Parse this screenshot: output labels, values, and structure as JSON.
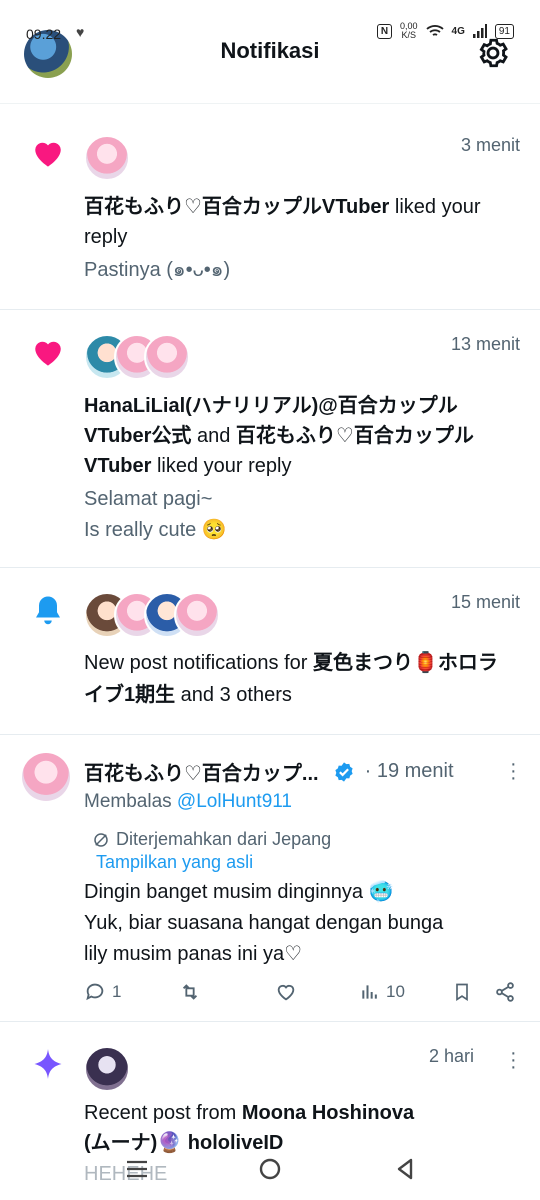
{
  "status": {
    "time": "09.22",
    "net_speed_value": "0,00",
    "net_speed_unit": "K/S",
    "network": "4G",
    "battery": "91"
  },
  "header": {
    "title": "Notifikasi"
  },
  "notifications": [
    {
      "type": "like",
      "time": "3 menit",
      "name1": "百花もふり♡百合カップルVTuber",
      "action": " liked your reply",
      "snippet": [
        "Pastinya (๑•ᴗ•๑)"
      ]
    },
    {
      "type": "like",
      "time": "13 menit",
      "name1": "HanaLiLial(ハナリリアル)@百合カップルVTuber公式",
      "joiner": " and ",
      "name2": "百花もふり♡百合カップルVTuber",
      "action": " liked your reply",
      "snippet": [
        "Selamat pagi~",
        "Is really cute 🥺"
      ]
    },
    {
      "type": "bell",
      "time": "15 menit",
      "prefix": "New post notifications for ",
      "name1": "夏色まつり🏮ホロライブ1期生",
      "suffix": " and 3 others"
    }
  ],
  "reply_tweet": {
    "author": "百花もふり♡百合カップ...",
    "time": "· 19 menit",
    "replying_label": "Membalas ",
    "replying_handle": "@LolHunt911",
    "translated_label": "Diterjemahkan dari Jepang",
    "show_original": "Tampilkan yang asli",
    "body": [
      "Dingin banget musim dinginnya 🥶",
      "Yuk, biar suasana hangat dengan bunga",
      "lily musim panas ini ya♡"
    ],
    "replies": "1",
    "views": "10"
  },
  "recent_post": {
    "time": "2 hari",
    "prefix": "Recent post from ",
    "name": "Moona Hoshinova",
    "name_line2": "(ムーナ)🔮 hololiveID",
    "snippet": "HEHEHE"
  },
  "colors": {
    "like_pink": "#f91880",
    "bell_blue": "#1d9bf0",
    "sparkle_purple": "#7856ff",
    "secondary_text": "#536471",
    "link_blue": "#1d9bf0"
  }
}
